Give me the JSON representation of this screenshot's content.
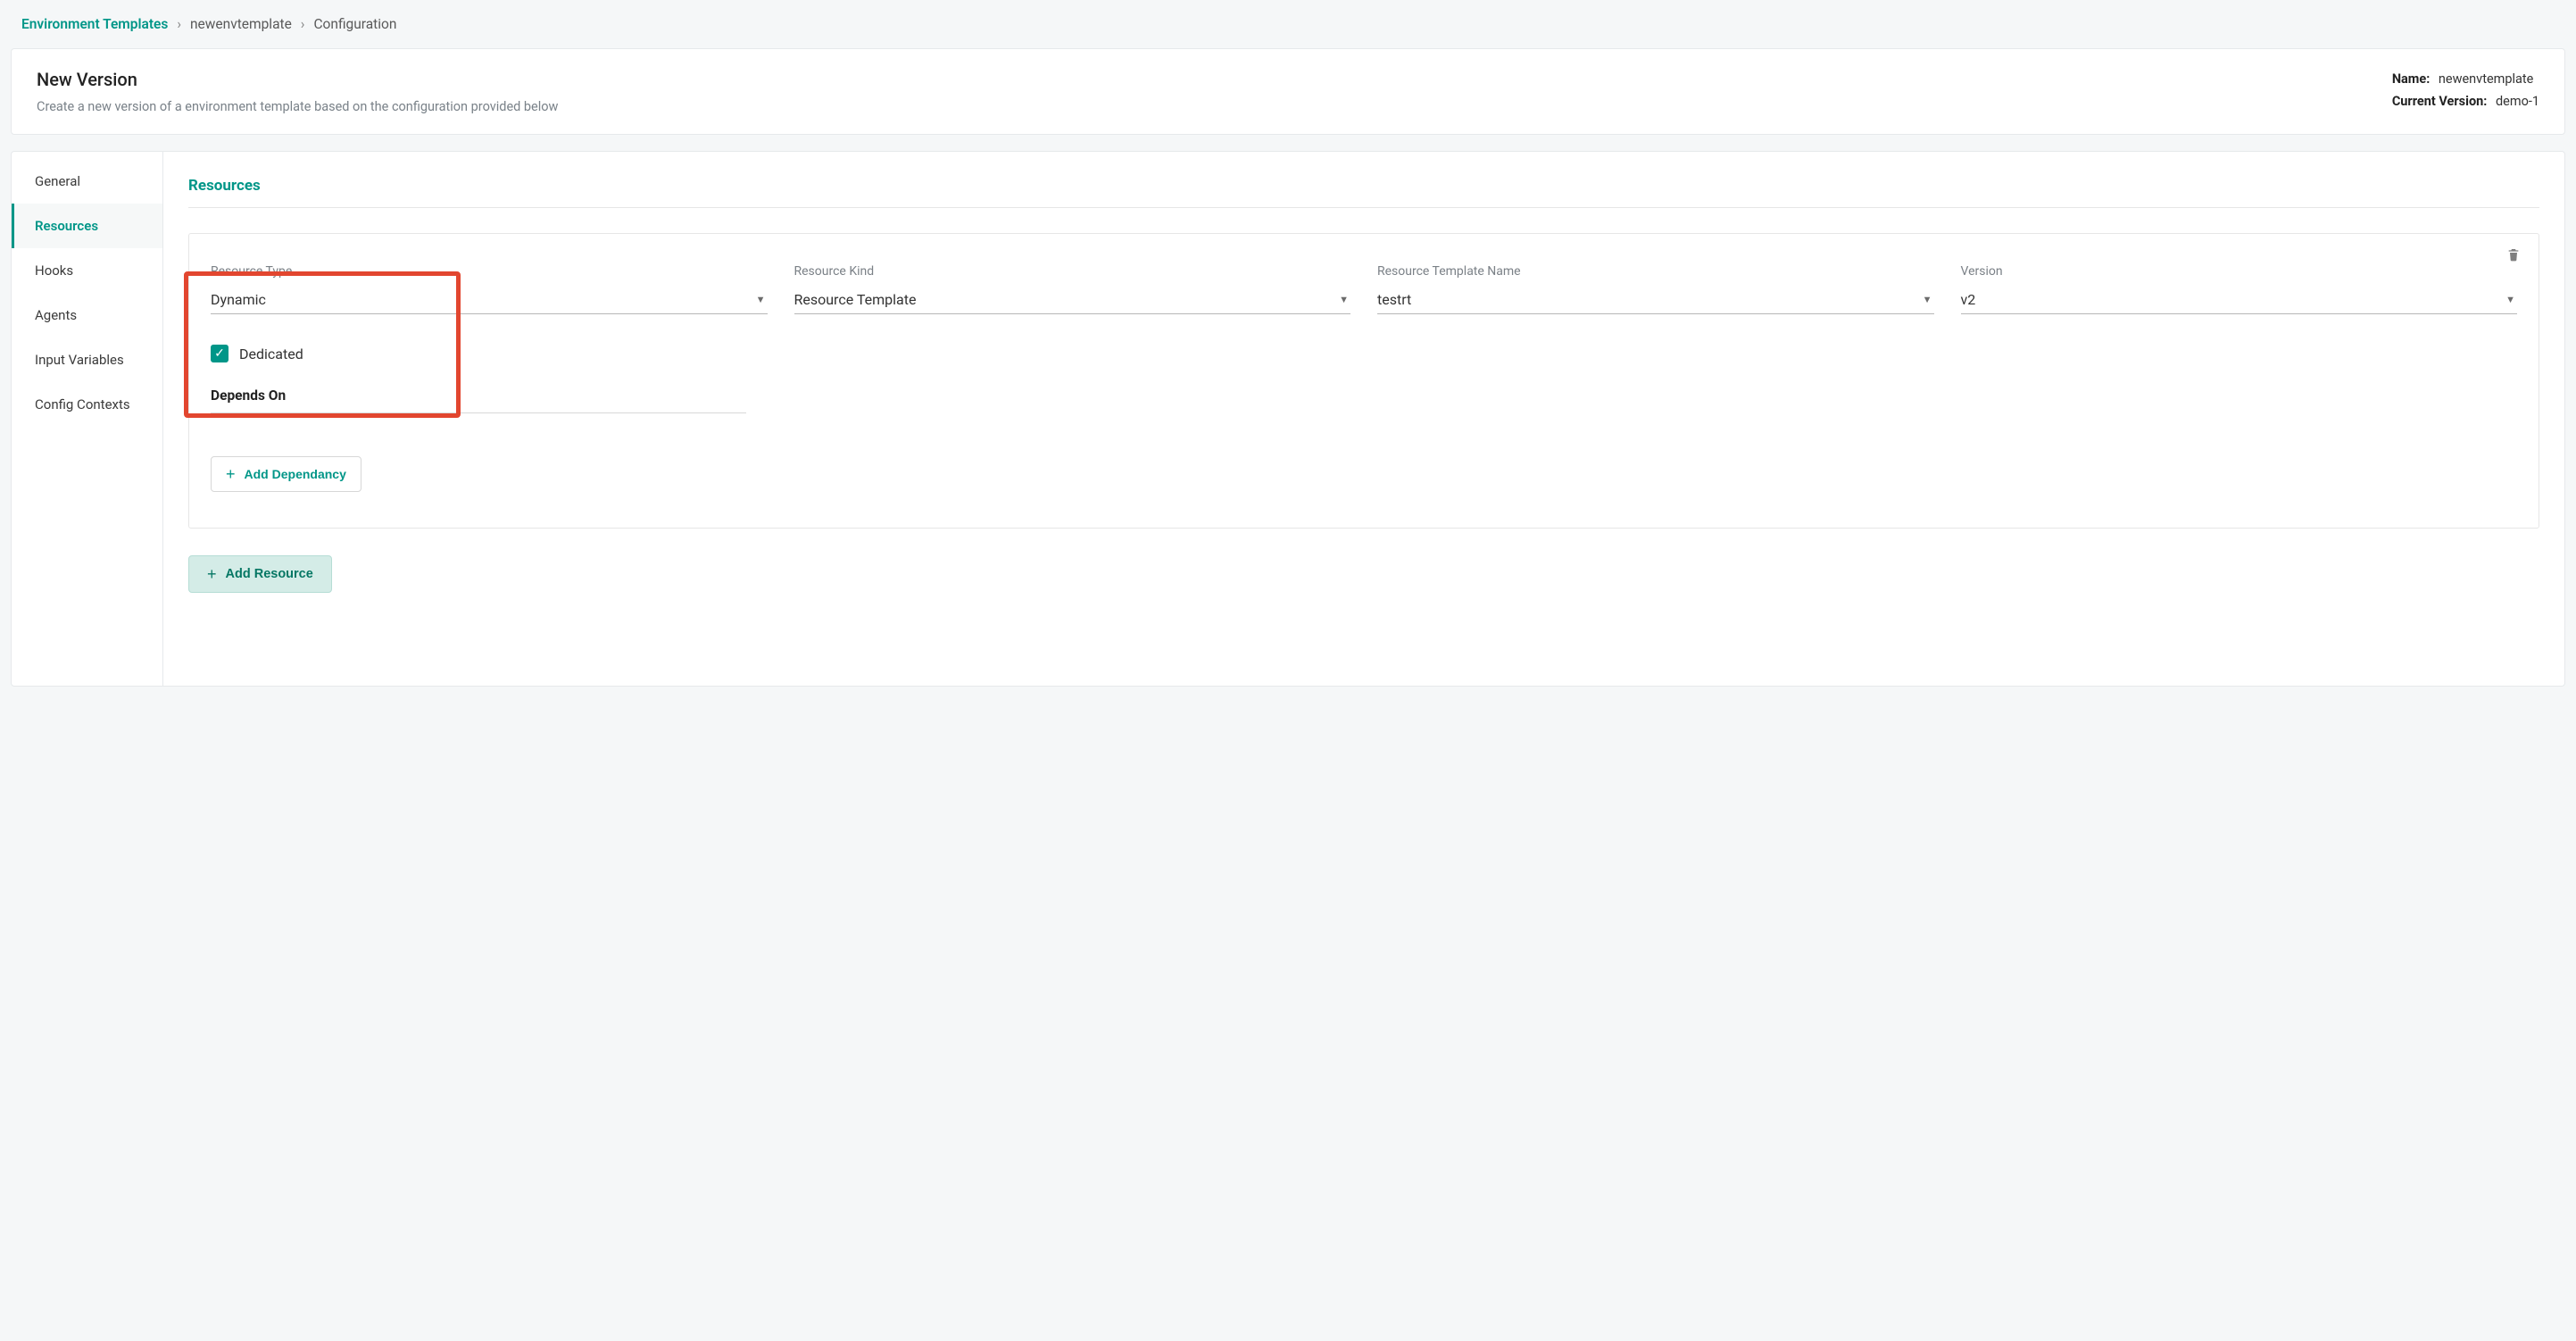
{
  "breadcrumb": {
    "root": "Environment Templates",
    "item": "newenvtemplate",
    "leaf": "Configuration"
  },
  "header": {
    "title": "New Version",
    "subtitle": "Create a new version of a environment template based on the configuration provided below",
    "name_label": "Name:",
    "name_value": "newenvtemplate",
    "version_label": "Current Version:",
    "version_value": "demo-1"
  },
  "sidenav": {
    "items": [
      {
        "label": "General",
        "active": false
      },
      {
        "label": "Resources",
        "active": true
      },
      {
        "label": "Hooks",
        "active": false
      },
      {
        "label": "Agents",
        "active": false
      },
      {
        "label": "Input Variables",
        "active": false
      },
      {
        "label": "Config Contexts",
        "active": false
      }
    ]
  },
  "section": {
    "title": "Resources"
  },
  "resource": {
    "fields": {
      "type": {
        "label": "Resource Type",
        "value": "Dynamic"
      },
      "kind": {
        "label": "Resource Kind",
        "value": "Resource Template"
      },
      "tmpl": {
        "label": "Resource Template Name",
        "value": "testrt"
      },
      "ver": {
        "label": "Version",
        "value": "v2"
      }
    },
    "dedicated": {
      "label": "Dedicated",
      "checked": true
    },
    "depends_label": "Depends On",
    "add_dep_label": "Add Dependancy"
  },
  "add_resource_label": "Add Resource"
}
